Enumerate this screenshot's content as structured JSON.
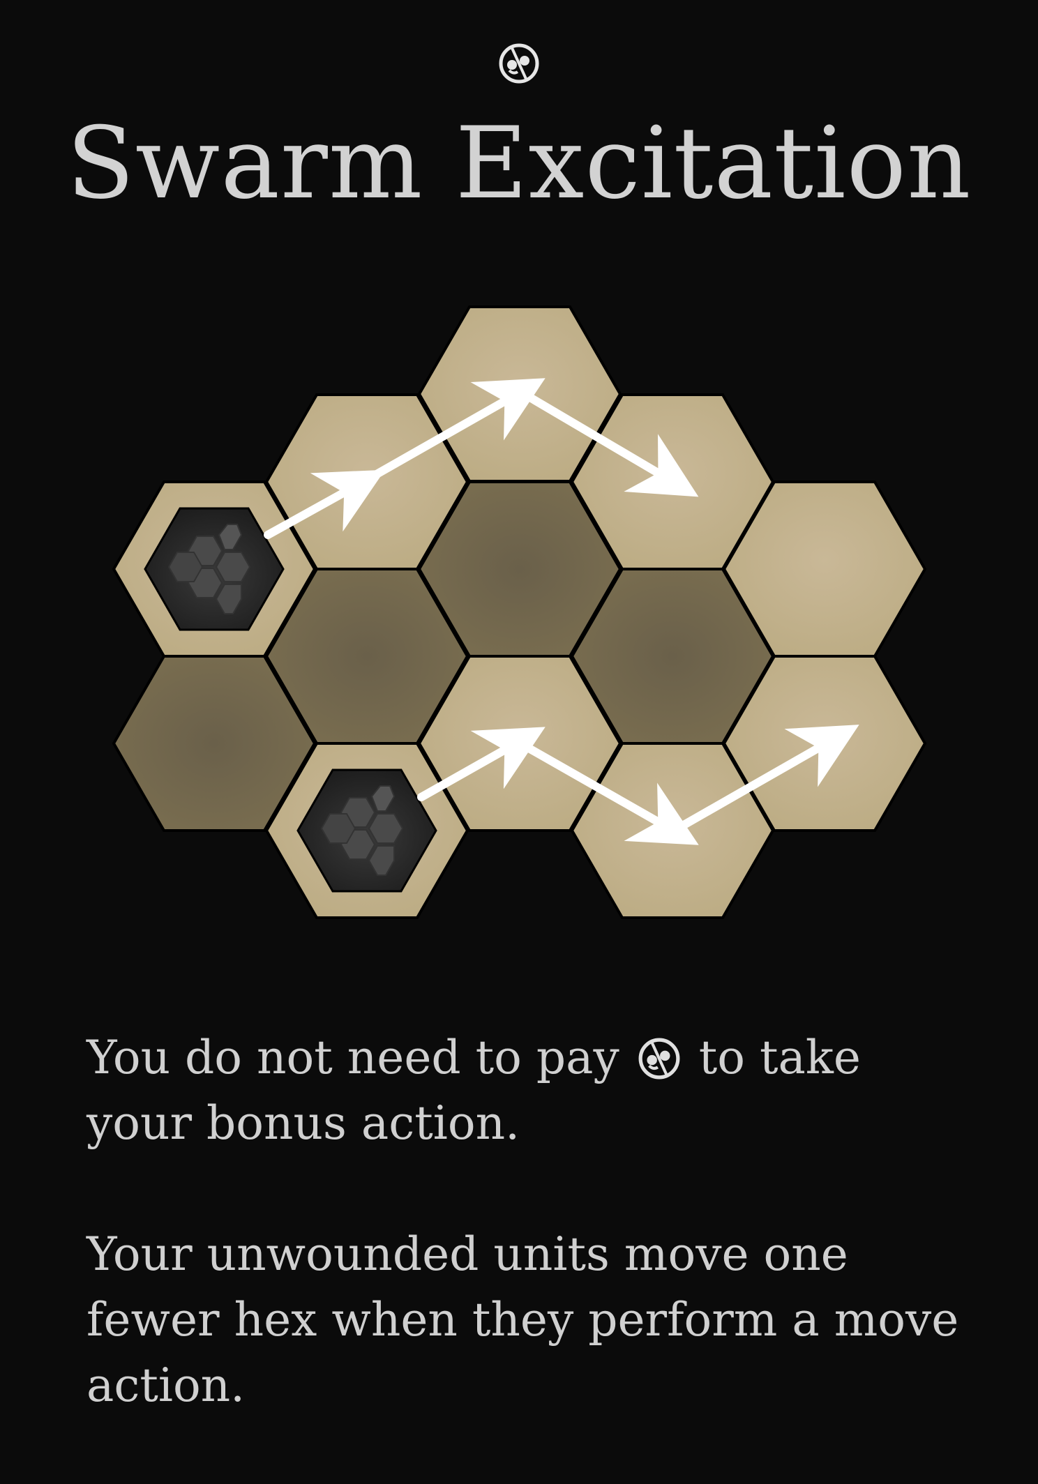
{
  "card": {
    "title": "Swarm Excitation",
    "cost_icon": "swarm-token-icon",
    "rules": [
      {
        "before_icon": "You do not need to pay",
        "icon": "swarm-token-icon",
        "after_icon": "to take your bonus action."
      },
      {
        "text": "Your unwounded units move one fewer hex when they perform a move action."
      }
    ]
  },
  "board": {
    "colors": {
      "light_hex": "#c4b491",
      "dark_hex": "#6f6549",
      "unit_fill": "#2a2a2a",
      "arrow": "#ffffff",
      "background": "#0b0b0b"
    },
    "hexes": [
      {
        "id": "hex-0-left",
        "shade": "light",
        "unit": true
      },
      {
        "id": "hex-1",
        "shade": "light",
        "unit": false
      },
      {
        "id": "hex-2-top",
        "shade": "light",
        "unit": false
      },
      {
        "id": "hex-3",
        "shade": "light",
        "unit": false
      },
      {
        "id": "hex-4",
        "shade": "dark",
        "unit": false
      },
      {
        "id": "hex-5",
        "shade": "light",
        "unit": false
      },
      {
        "id": "hex-6",
        "shade": "dark",
        "unit": false
      },
      {
        "id": "hex-7",
        "shade": "dark",
        "unit": false
      },
      {
        "id": "hex-8",
        "shade": "dark",
        "unit": false
      },
      {
        "id": "hex-9",
        "shade": "light",
        "unit": true
      },
      {
        "id": "hex-10",
        "shade": "light",
        "unit": false
      },
      {
        "id": "hex-11",
        "shade": "light",
        "unit": false
      },
      {
        "id": "hex-12",
        "shade": "light",
        "unit": false
      }
    ],
    "move_paths": [
      {
        "unit": "upper",
        "steps": 3
      },
      {
        "unit": "lower",
        "steps": 3
      }
    ]
  }
}
